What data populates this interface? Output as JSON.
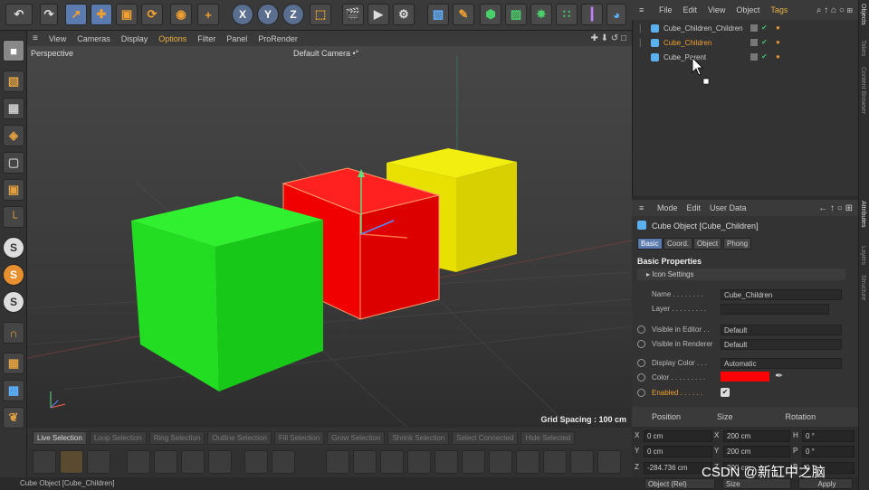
{
  "viewport_menu": [
    "View",
    "Cameras",
    "Display",
    "Options",
    "Filter",
    "Panel",
    "ProRender"
  ],
  "viewport": {
    "label": "Perspective",
    "camera": "Default Camera",
    "camera_suffix": "•°",
    "grid_spacing": "Grid Spacing : 100 cm"
  },
  "objects_menu": [
    "File",
    "Edit",
    "View",
    "Object",
    "Tags"
  ],
  "objects": [
    {
      "name": "Cube_Children_Children",
      "selected": false
    },
    {
      "name": "Cube_Children",
      "selected": true
    },
    {
      "name": "Cube_Parent",
      "selected": false
    }
  ],
  "attributes_menu": [
    "Mode",
    "Edit",
    "User Data"
  ],
  "attributes": {
    "title": "Cube Object [Cube_Children]",
    "tabs": [
      "Basic",
      "Coord.",
      "Object",
      "Phong"
    ],
    "section": "Basic Properties",
    "icon_settings": "▸ Icon Settings",
    "name_label": "Name . . . . . . . .",
    "name_value": "Cube_Children",
    "layer_label": "Layer . . . . . . . . .",
    "vis_editor_label": "Visible in Editor . .",
    "vis_editor_value": "Default",
    "vis_render_label": "Visible in Renderer",
    "vis_render_value": "Default",
    "display_color_label": "Display Color . . .",
    "display_color_value": "Automatic",
    "color_label": "Color . . . . . . . . .",
    "color_value": "#ff0000",
    "enabled_label": "Enabled . . . . . .",
    "enabled_checked": "✔"
  },
  "coords": {
    "headers": [
      "Position",
      "Size",
      "Rotation"
    ],
    "rows": [
      {
        "axis": "X",
        "pos": "0 cm",
        "sax": "X",
        "size": "200 cm",
        "rax": "H",
        "rot": "0 °"
      },
      {
        "axis": "Y",
        "pos": "0 cm",
        "sax": "Y",
        "size": "200 cm",
        "rax": "P",
        "rot": "0 °"
      },
      {
        "axis": "Z",
        "pos": "-284.736 cm",
        "sax": "Z",
        "size": "200 cm",
        "rax": "B",
        "rot": "0 °"
      }
    ],
    "bottom": [
      "Object (Rel)",
      "Size",
      "Apply"
    ]
  },
  "modes": [
    "Live Selection",
    "Loop Selection",
    "Ring Selection",
    "Outline Selection",
    "Phong Break Selection",
    "Fill Selection",
    "Path Selection",
    "Select Connected",
    "Grow Selection",
    "Shrink Selection",
    "Hide Selected"
  ],
  "status": "Cube Object [Cube_Children]",
  "right_tabs": [
    "Objects",
    "Takes",
    "Content Browser",
    "Attributes",
    "Layers",
    "Structure"
  ],
  "watermark": "CSDN @新缸中之脑",
  "colors": {
    "accent": "#f0a030",
    "selected_tab": "#5a7ab0",
    "cube_red": "#ff0000",
    "cube_green": "#22dd22",
    "cube_yellow": "#e8e000"
  },
  "toolbar_icons": [
    "undo-icon",
    "live-selection-icon",
    "move-icon",
    "scale-icon",
    "rotate-icon",
    "psr-icon",
    "add-icon",
    "x-axis",
    "y-axis",
    "z-axis",
    "world-coords-icon",
    "render-view-icon",
    "render-icon",
    "render-settings-icon",
    "cube-icon",
    "pen-icon",
    "subdivision-icon",
    "array-icon",
    "effector-icon",
    "cloner-icon",
    "deformer-icon",
    "camera-icon"
  ],
  "toolbar_labels": [
    "X",
    "Y",
    "Z"
  ]
}
